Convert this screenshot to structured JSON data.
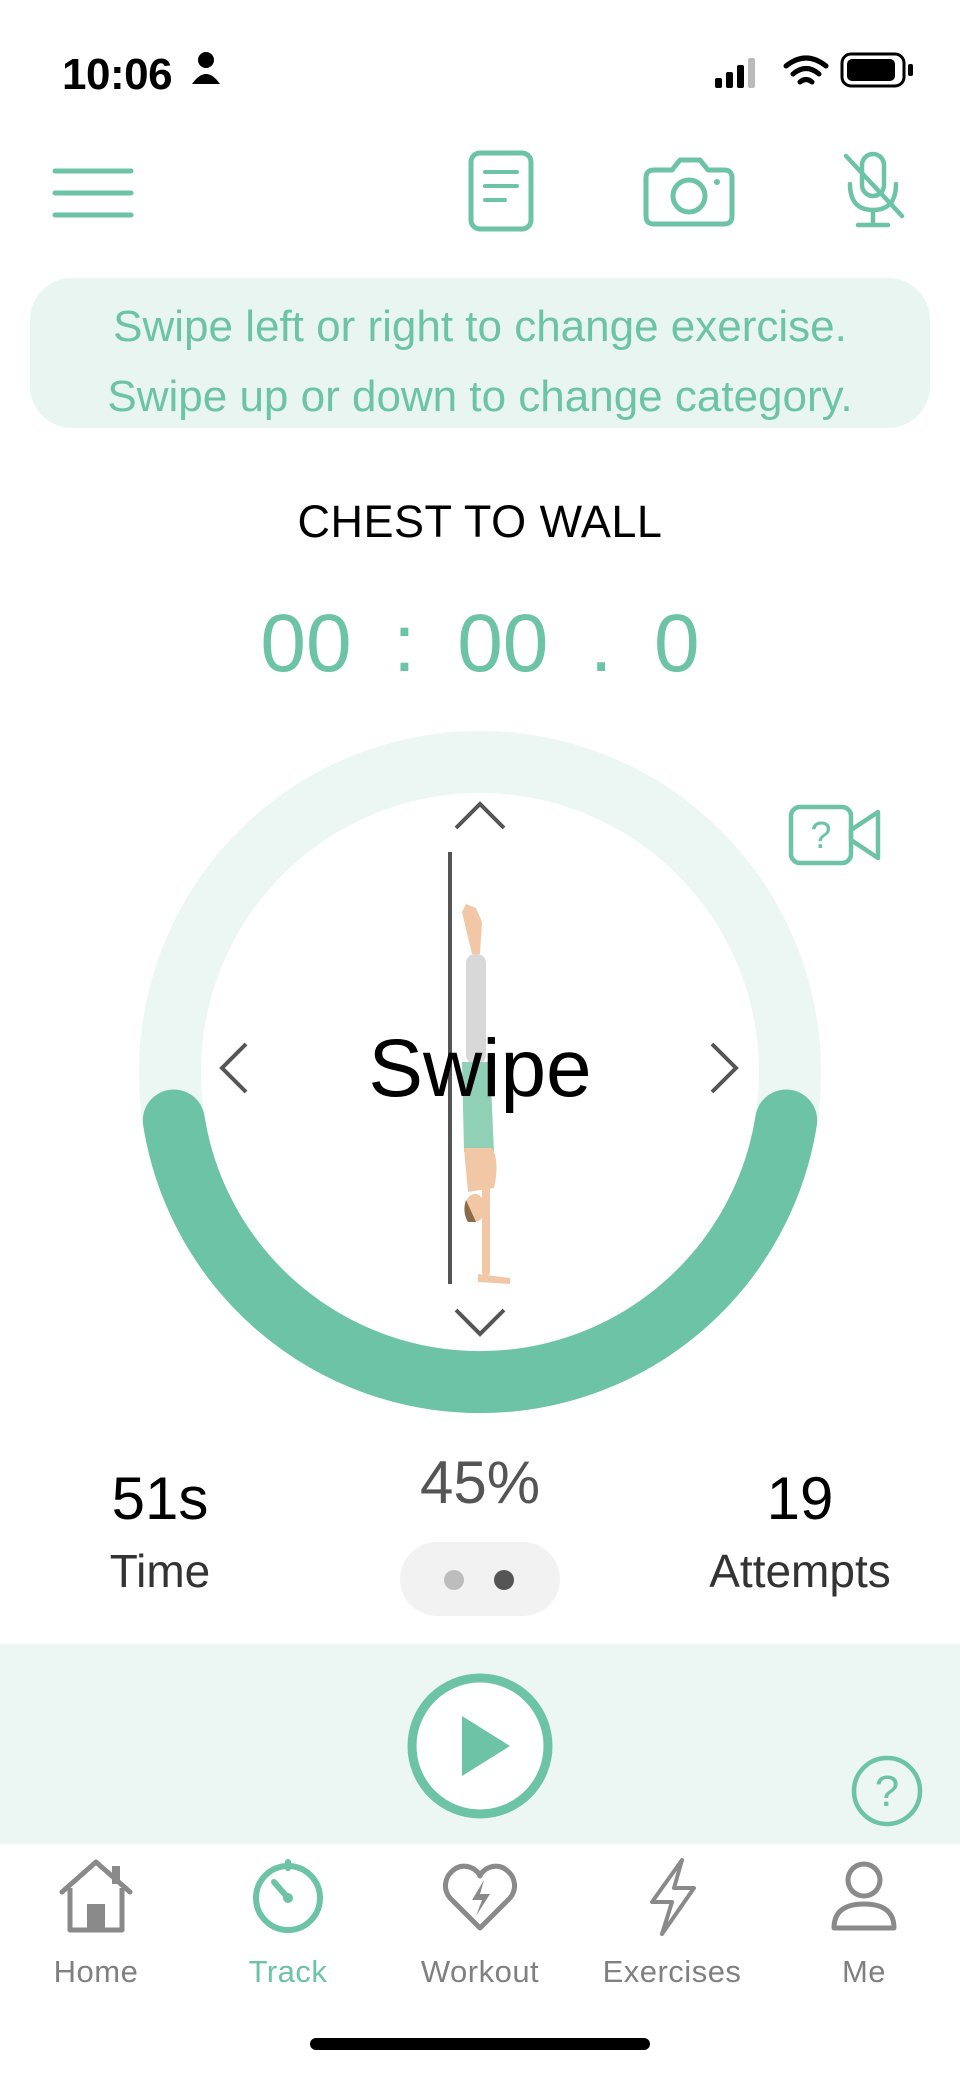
{
  "status_bar": {
    "time": "10:06"
  },
  "toolbar": {
    "menu_icon": "hamburger-menu-icon",
    "notes_icon": "notes-icon",
    "camera_icon": "camera-icon",
    "mic_icon": "microphone-muted-icon"
  },
  "hint": {
    "line1": "Swipe left or right to change exercise.",
    "line2": "Swipe up or down to change category."
  },
  "exercise": {
    "name": "CHEST TO WALL"
  },
  "timer": {
    "minutes": "00",
    "sep1": ":",
    "seconds": "00",
    "sep2": ".",
    "tenths": "0"
  },
  "dial": {
    "label": "Swipe",
    "progress": 0.45,
    "video_help_icon": "video-help-icon"
  },
  "stats": {
    "time_value": "51s",
    "time_label": "Time",
    "percent_value": "45%",
    "attempts_value": "19",
    "attempts_label": "Attempts"
  },
  "pager": {
    "count": 2,
    "active_index": 1
  },
  "tabs": [
    {
      "label": "Home",
      "icon": "home-icon"
    },
    {
      "label": "Track",
      "icon": "stopwatch-icon",
      "active": true
    },
    {
      "label": "Workout",
      "icon": "heart-bolt-icon"
    },
    {
      "label": "Exercises",
      "icon": "lightning-icon"
    },
    {
      "label": "Me",
      "icon": "person-icon"
    }
  ],
  "colors": {
    "accent": "#6cc3a6",
    "accent_light": "#e8f5f0",
    "inactive": "#808080"
  }
}
